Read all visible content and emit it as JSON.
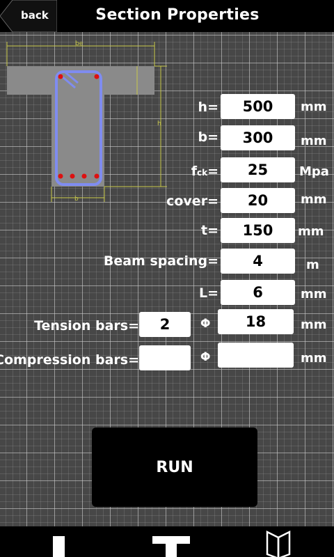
{
  "header": {
    "back_label": "back",
    "title": "Section Properties"
  },
  "diagram": {
    "flange_width_label": "be",
    "height_label": "h",
    "web_width_label": "b"
  },
  "fields": [
    {
      "key": "h",
      "label": "h=",
      "value": "500",
      "unit": "mm"
    },
    {
      "key": "b",
      "label": "b=",
      "value": "300",
      "unit": "mm"
    },
    {
      "key": "fck",
      "label_main": "f",
      "label_sub": "ck",
      "label_eq": "=",
      "value": "25",
      "unit": "Mpa"
    },
    {
      "key": "cover",
      "label": "cover=",
      "value": "20",
      "unit": "mm"
    },
    {
      "key": "t",
      "label": "t=",
      "value": "150",
      "unit": "mm"
    },
    {
      "key": "beam_spacing",
      "label": "Beam spacing=",
      "value": "4",
      "unit": "m"
    },
    {
      "key": "L",
      "label": "L=",
      "value": "6",
      "unit": "mm"
    }
  ],
  "tension": {
    "label": "Tension bars=",
    "count": "2",
    "phi": "Φ",
    "diameter": "18",
    "unit": "mm"
  },
  "compression": {
    "label": "Compression bars=",
    "count": "",
    "phi": "Φ",
    "diameter": "",
    "unit": "mm"
  },
  "run_label": "RUN",
  "bottom_nav": [
    "rectangular-section-icon",
    "t-section-icon",
    "book-icon"
  ],
  "colors": {
    "rebar": "#dd1111",
    "stirrup": "#7f8cf0",
    "dimension": "#c8c84a",
    "concrete": "#8a8a8a"
  }
}
